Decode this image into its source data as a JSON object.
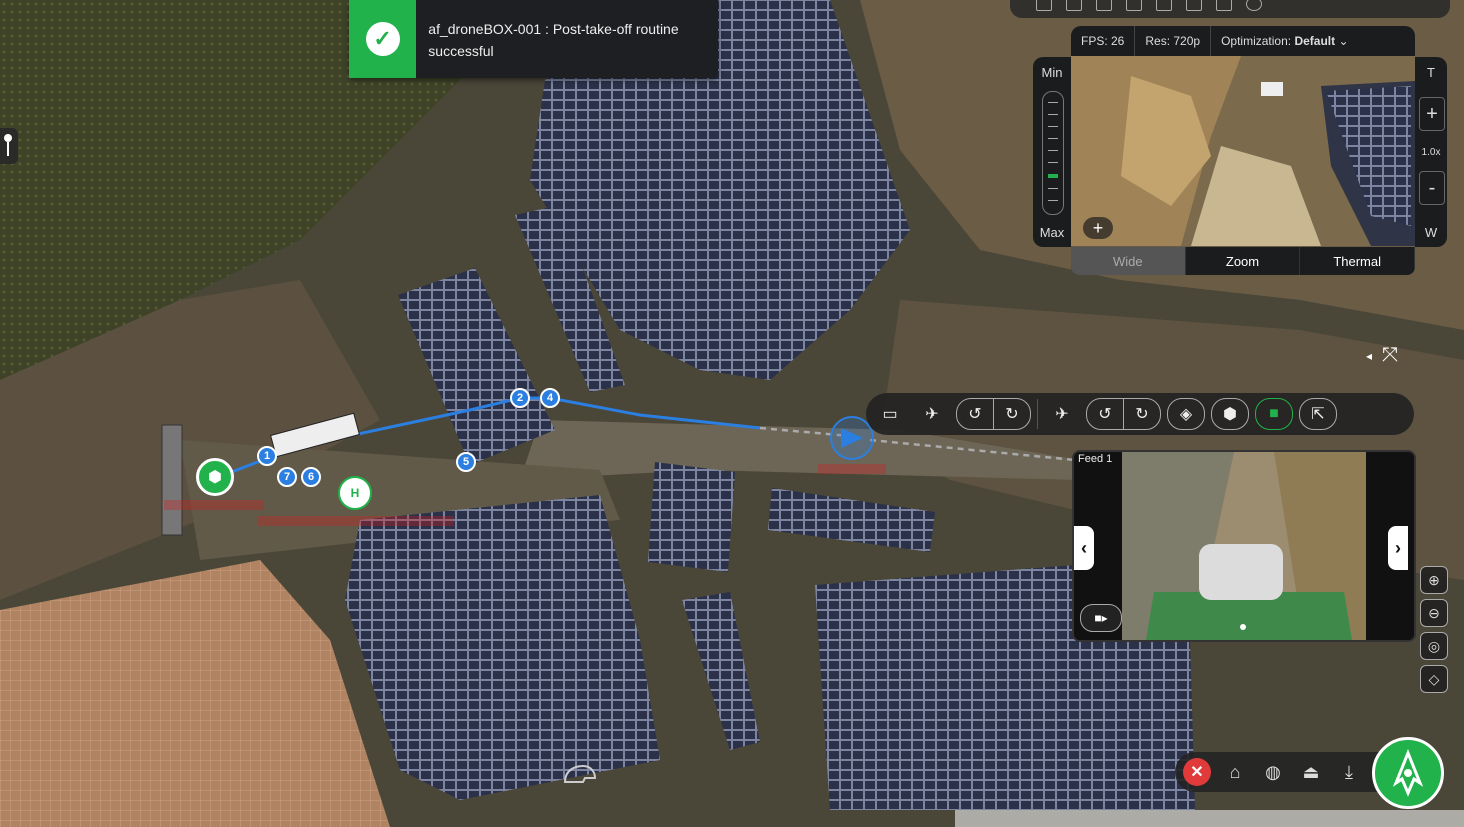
{
  "notification": {
    "message": "af_droneBOX-001 : Post-take-off routine successful",
    "status_icon": "check-icon",
    "color": "#21b24b"
  },
  "camera": {
    "fps": "FPS: 26",
    "res": "Res: 720p",
    "optimization_label": "Optimization:",
    "optimization_value": "Default",
    "zoom_min": "Min",
    "zoom_max": "Max",
    "tele": "T",
    "wide_short": "W",
    "zoom_in": "+",
    "zoom_out": "-",
    "zoom_level": "1.0x",
    "add": "+",
    "tabs": [
      "Wide",
      "Zoom",
      "Thermal"
    ],
    "active_tab": "Wide"
  },
  "feed": {
    "label": "Feed 1",
    "prev": "‹",
    "next": "›"
  },
  "map": {
    "waypoints": [
      "1",
      "2",
      "4",
      "5",
      "6",
      "7"
    ],
    "home_marker": "H",
    "route_color": "#2b7fe0",
    "dock_color": "#21b24b"
  },
  "colors": {
    "accent": "#21b24b",
    "danger": "#e03a3a",
    "route": "#2b7fe0"
  }
}
